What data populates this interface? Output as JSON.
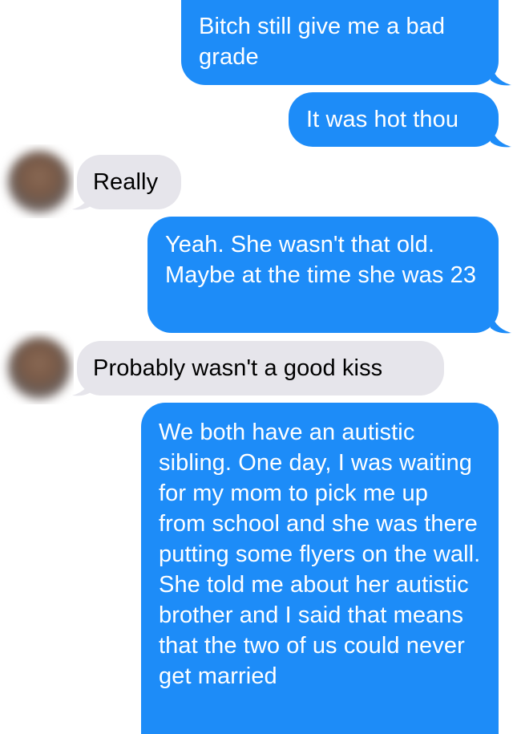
{
  "conversation": {
    "messages": [
      {
        "from": "me",
        "text": "Bitch still give me a bad grade"
      },
      {
        "from": "me",
        "text": "It was hot thou"
      },
      {
        "from": "them",
        "text": "Really"
      },
      {
        "from": "me",
        "text": "Yeah. She wasn't that old. Maybe at the time she was 23"
      },
      {
        "from": "them",
        "text": "Probably wasn't a good kiss"
      },
      {
        "from": "me",
        "text": "We both have an autistic sibling. One day, I was waiting for my mom to pick me up from school and she was there putting some flyers on the wall. She told me about her autistic brother and I said that means that the two of us could never get married"
      }
    ]
  },
  "colors": {
    "sent_bubble": "#1d8cf8",
    "received_bubble": "#e6e5eb",
    "sent_text": "#ffffff",
    "received_text": "#000000"
  }
}
